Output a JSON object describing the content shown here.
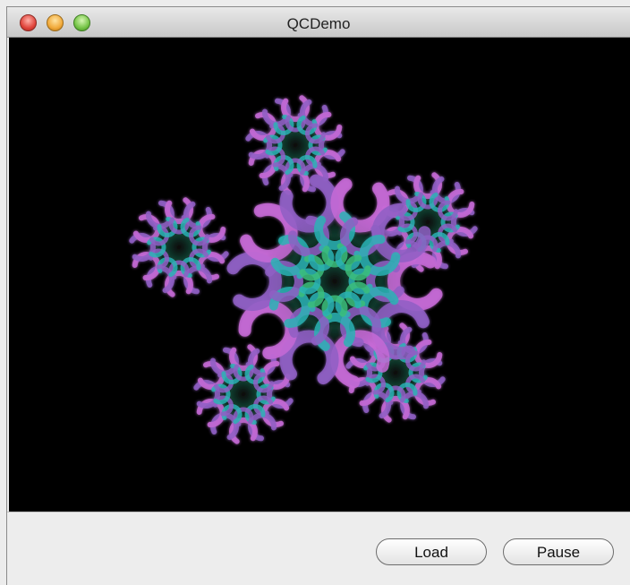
{
  "window": {
    "title": "QCDemo"
  },
  "controls": {
    "traffic_lights": [
      "close",
      "minimize",
      "zoom"
    ]
  },
  "buttons": {
    "load_label": "Load",
    "pause_label": "Pause"
  },
  "colors": {
    "canvas_bg": "#000000",
    "petal_pink": "#c66ad6",
    "petal_violet": "#8f5fc4",
    "petal_teal": "#2bb3b5"
  },
  "icons": [
    "close-icon",
    "minimize-icon",
    "zoom-icon"
  ]
}
